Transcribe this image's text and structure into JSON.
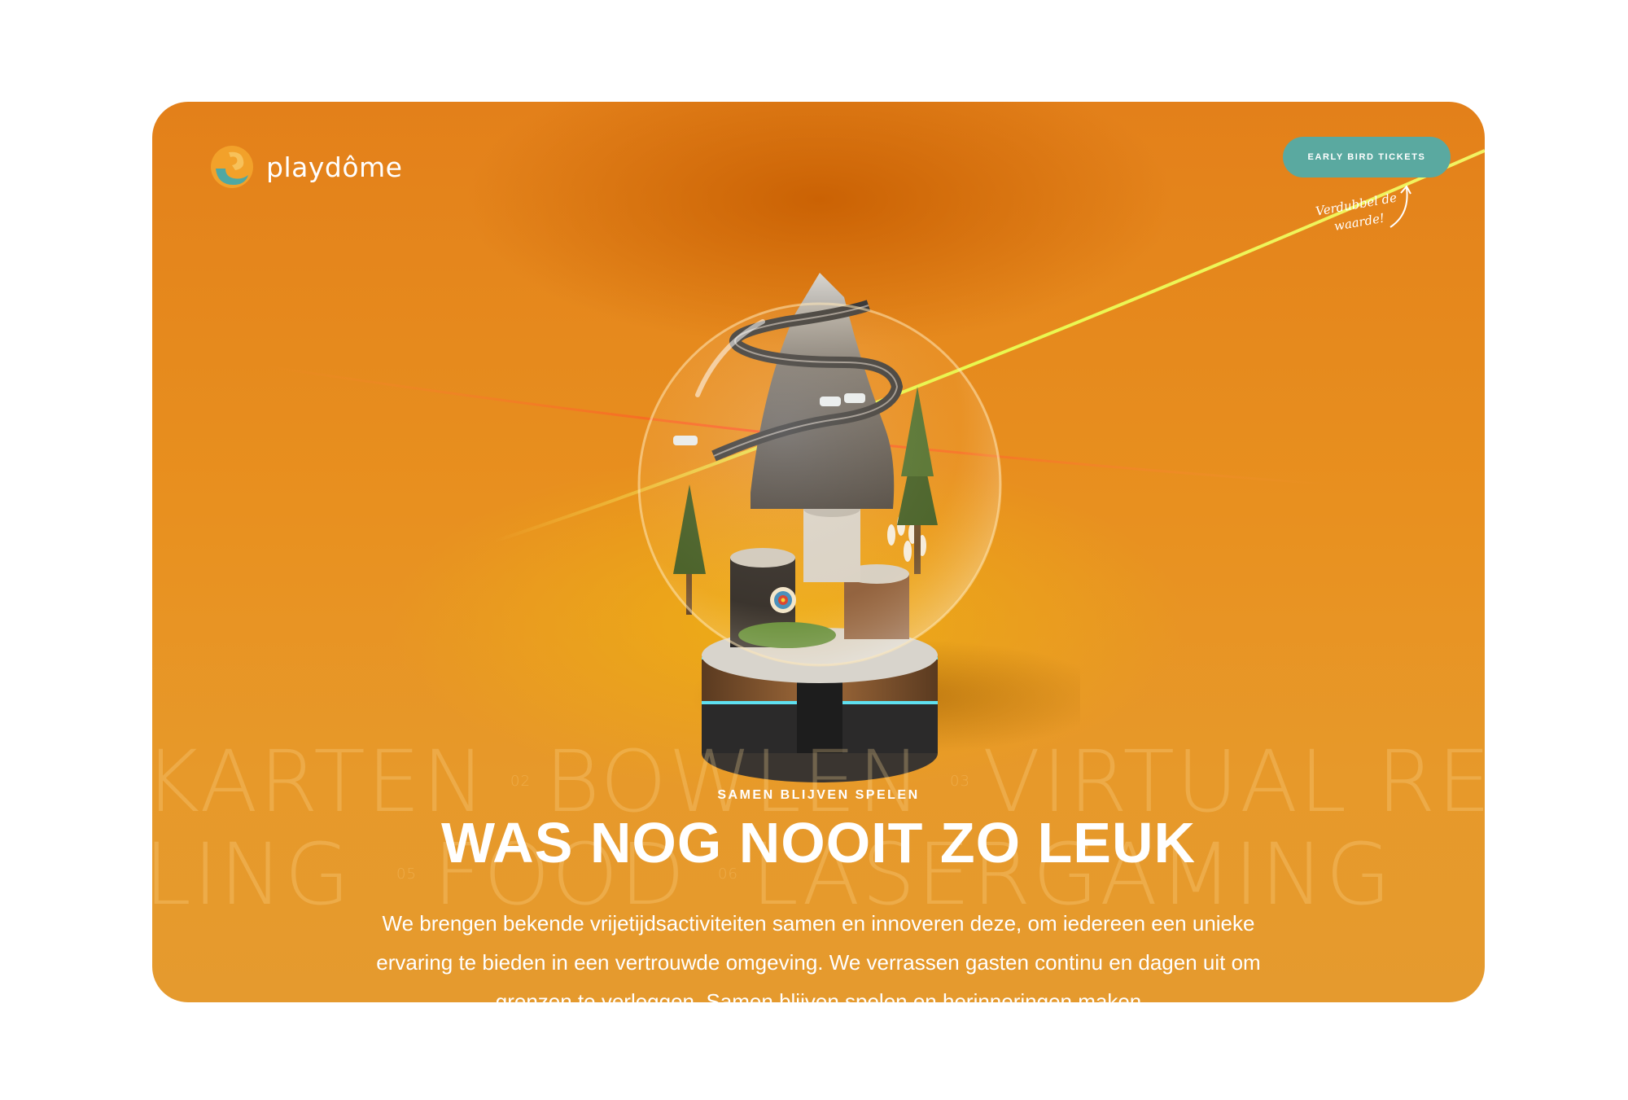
{
  "brand": {
    "name": "playdôme"
  },
  "header": {
    "cta_label": "EARLY BIRD TICKETS",
    "cta_note": "Verdubbel de waarde!"
  },
  "activities": {
    "words": [
      "KARTEN",
      "BOWLEN",
      "VIRTUAL REA",
      "LING",
      "FOOD",
      "LASERGAMING"
    ],
    "numbers": [
      "02",
      "03",
      "05",
      "06"
    ]
  },
  "hero": {
    "eyebrow": "SAMEN BLIJVEN SPELEN",
    "headline": "WAS NOG NOOIT ZO LEUK",
    "body": "We brengen bekende vrijetijdsactiviteiten samen en innoveren deze, om iedereen een unieke ervaring te bieden in een vertrouwde omgeving. We verrassen gasten continu en dagen uit om grenzen te verleggen. Samen blijven spelen en herinneringen maken"
  },
  "colors": {
    "background": "#e8901f",
    "accent": "#5aa9a0",
    "text": "#ffffff"
  }
}
